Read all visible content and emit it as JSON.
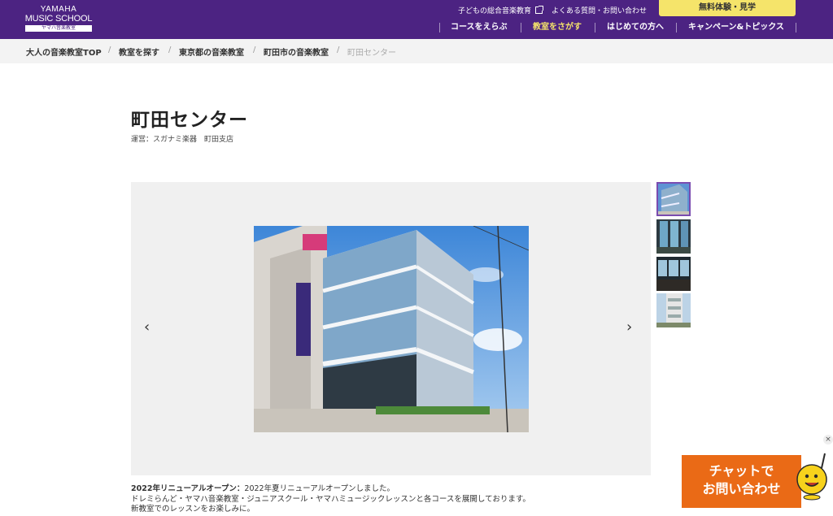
{
  "header": {
    "logo_line1": "YAMAHA",
    "logo_line2": "MUSIC SCHOOL",
    "logo_line3": "ヤマハ音楽教室",
    "util_links": [
      {
        "label": "子どもの総合音楽教育",
        "icon": "external-link-icon"
      },
      {
        "label": "よくある質問・お問い合わせ"
      }
    ],
    "trial_button": "無料体験・見学",
    "nav": [
      {
        "label": "コースをえらぶ",
        "active": false
      },
      {
        "label": "教室をさがす",
        "active": true
      },
      {
        "label": "はじめての方へ",
        "active": false
      },
      {
        "label": "キャンペーン&トピックス",
        "active": false
      }
    ],
    "colors": {
      "brand": "#4c2382",
      "accent": "#f5e46a",
      "chat": "#ea6a16"
    }
  },
  "breadcrumb": {
    "separator": "/",
    "items": [
      "大人の音楽教室TOP",
      "教室を探す",
      "東京都の音楽教室",
      "町田市の音楽教室",
      "町田センター"
    ]
  },
  "main": {
    "title": "町田センター",
    "operator": "運営：スガナミ楽器　町田支店",
    "gallery": {
      "prev_icon": "chevron-left-icon",
      "next_icon": "chevron-right-icon",
      "prev_glyph": "‹",
      "next_glyph": "›",
      "thumbnail_count": 4,
      "selected_index": 0
    },
    "description": {
      "heading": "2022年リニューアルオープン：",
      "lead": "2022年夏リニューアルオープンしました。",
      "line2": "ドレミらんど・ヤマハ音楽教室・ジュニアスクール・ヤマハミュージックレッスンと各コースを展開しております。",
      "line3": "新教室でのレッスンをお楽しみに。"
    }
  },
  "chat": {
    "line1": "チャットで",
    "line2": "お問い合わせ",
    "close_glyph": "×"
  }
}
